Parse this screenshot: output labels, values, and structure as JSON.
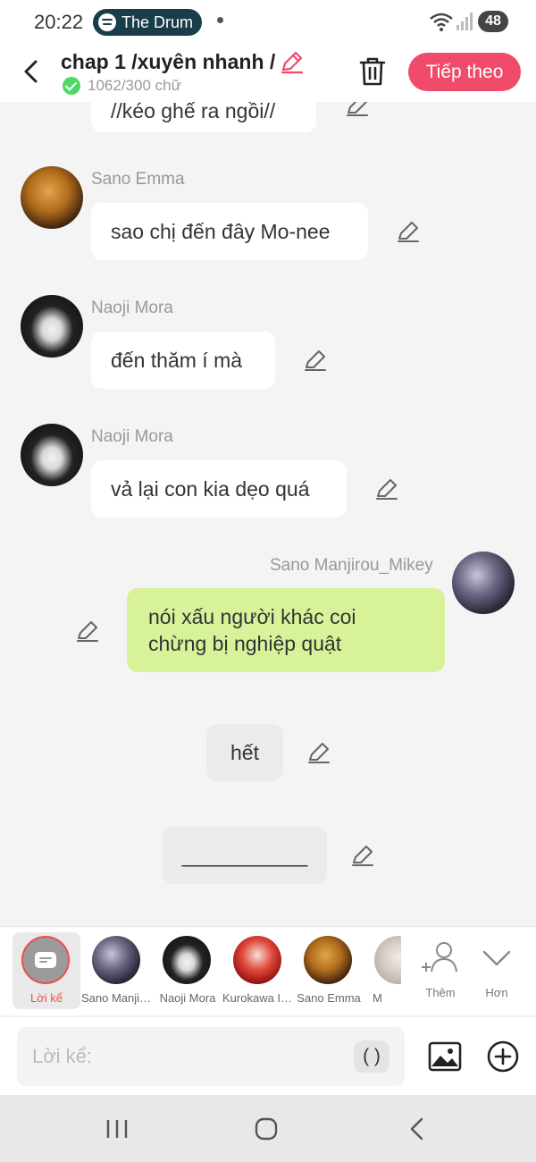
{
  "status_bar": {
    "time": "20:22",
    "notification": "The Drum",
    "battery": "48"
  },
  "header": {
    "title": "chap 1 /xuyên nhanh /",
    "word_count": "1062/300 chữ",
    "next_button": "Tiếp theo"
  },
  "messages": [
    {
      "type": "left",
      "sender": "",
      "text": "//kéo ghế ra ngồi//"
    },
    {
      "type": "left",
      "sender": "Sano Emma",
      "text": "sao chị đến đây Mo-nee",
      "avatar": "sano-emma"
    },
    {
      "type": "left",
      "sender": "Naoji Mora",
      "text": "đến thăm í mà",
      "avatar": "naoji-mora"
    },
    {
      "type": "left",
      "sender": "Naoji Mora",
      "text": "vả lại con kia dẹo quá",
      "avatar": "naoji-mora"
    },
    {
      "type": "right",
      "sender": "Sano Manjirou_Mikey",
      "lines": [
        "nói xấu người khác coi",
        "chừng bị nghiệp quật"
      ],
      "avatar": "sano-manjirou"
    },
    {
      "type": "narration",
      "text": "hết"
    },
    {
      "type": "narration",
      "text": "___________"
    }
  ],
  "characters": [
    {
      "name": "Lời kể",
      "selected": true
    },
    {
      "name": "Sano Manjirou_Mikey"
    },
    {
      "name": "Naoji Mora"
    },
    {
      "name": "Kurokawa Izana"
    },
    {
      "name": "Sano Emma"
    },
    {
      "name": "M"
    }
  ],
  "tools": {
    "more": "Thêm",
    "expand": "Hơn"
  },
  "input": {
    "placeholder": "Lời kể:",
    "paren": "( )"
  },
  "colors": {
    "accent": "#f04b6a",
    "self_bubble": "#d8f29a",
    "selected_ring": "#e8524a"
  }
}
